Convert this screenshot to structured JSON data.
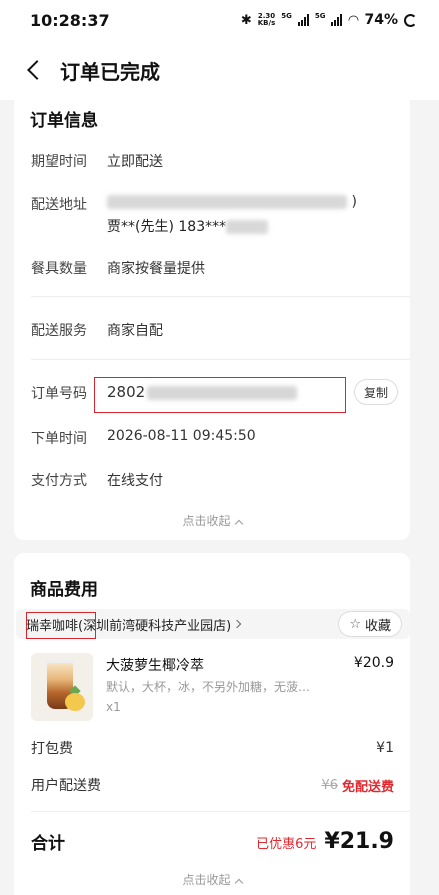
{
  "status_bar": {
    "time": "10:28:37",
    "net_speed": "2.30",
    "net_unit": "KB/s",
    "signal1_label": "5G",
    "signal2_label": "5G",
    "battery": "74%"
  },
  "header": {
    "title": "订单已完成"
  },
  "order_info": {
    "title": "订单信息",
    "expected_time_label": "期望时间",
    "expected_time_value": "立即配送",
    "address_label": "配送地址",
    "address_name": "贾**(先生)",
    "address_phone": "183***",
    "tableware_label": "餐具数量",
    "tableware_value": "商家按餐量提供",
    "delivery_service_label": "配送服务",
    "delivery_service_value": "商家自配",
    "order_no_label": "订单号码",
    "order_no_prefix": "2802",
    "copy_label": "复制",
    "order_time_label": "下单时间",
    "order_time_value": "2026-08-11 09:45:50",
    "payment_label": "支付方式",
    "payment_value": "在线支付",
    "collapse_label": "点击收起"
  },
  "goods": {
    "title": "商品费用",
    "store_brand": "瑞幸咖啡",
    "store_branch": "(深圳前湾硬科技产业园店)",
    "favorite_label": "收藏",
    "product": {
      "name": "大菠萝生椰冷萃",
      "spec": "默认，大杯，冰，不另外加糖，无菠…",
      "qty": "x1",
      "price": "¥20.9"
    },
    "packing_label": "打包费",
    "packing_value": "¥1",
    "delivery_fee_label": "用户配送费",
    "delivery_fee_original": "¥6",
    "delivery_fee_free": "免配送费",
    "total_label": "合计",
    "discount_label": "已优惠6元",
    "total_value": "¥21.9",
    "collapse_label": "点击收起"
  },
  "colors": {
    "accent_red": "#e0292f",
    "annotation_red": "#d8262f"
  },
  "icons": [
    "back-arrow-icon",
    "bluetooth-icon",
    "wifi-icon",
    "battery-icon",
    "star-icon",
    "chevron-right-icon",
    "chevron-up-icon"
  ]
}
